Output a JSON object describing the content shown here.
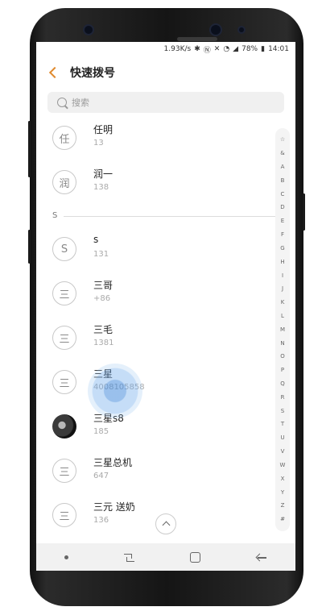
{
  "status": {
    "speed": "1.93K/s",
    "battery": "78%",
    "time": "14:01",
    "icons": [
      "bluetooth-icon",
      "nfc-icon",
      "mute-icon",
      "wifi-icon",
      "signal-icon",
      "battery-icon"
    ]
  },
  "header": {
    "title": "快速拨号"
  },
  "search": {
    "placeholder": "搜索"
  },
  "contacts_top": [
    {
      "name": "任明",
      "avatar": "任",
      "number": "13"
    },
    {
      "name": "润一",
      "avatar": "润",
      "number": "138"
    }
  ],
  "section": {
    "letter": "S"
  },
  "contacts_s": [
    {
      "name": "s",
      "avatar": "S",
      "number": "131"
    },
    {
      "name": "三哥",
      "avatar": "三",
      "number": "+86"
    },
    {
      "name": "三毛",
      "avatar": "三",
      "number": "1381"
    },
    {
      "name": "三星",
      "avatar": "三",
      "number": "4008105858"
    },
    {
      "name": "三星s8",
      "avatar": "",
      "number": "185"
    },
    {
      "name": "三星总机",
      "avatar": "三",
      "number": "647"
    },
    {
      "name": "三元 送奶",
      "avatar": "三",
      "number": "136",
      "number_tail": "6"
    }
  ],
  "index_letters": [
    "☆",
    "&",
    "A",
    "B",
    "C",
    "D",
    "E",
    "F",
    "G",
    "H",
    "I",
    "J",
    "K",
    "L",
    "M",
    "N",
    "O",
    "P",
    "Q",
    "R",
    "S",
    "T",
    "U",
    "V",
    "W",
    "X",
    "Y",
    "Z",
    "#"
  ],
  "colors": {
    "accent": "#e08a2e",
    "touch": "#468cdc"
  }
}
